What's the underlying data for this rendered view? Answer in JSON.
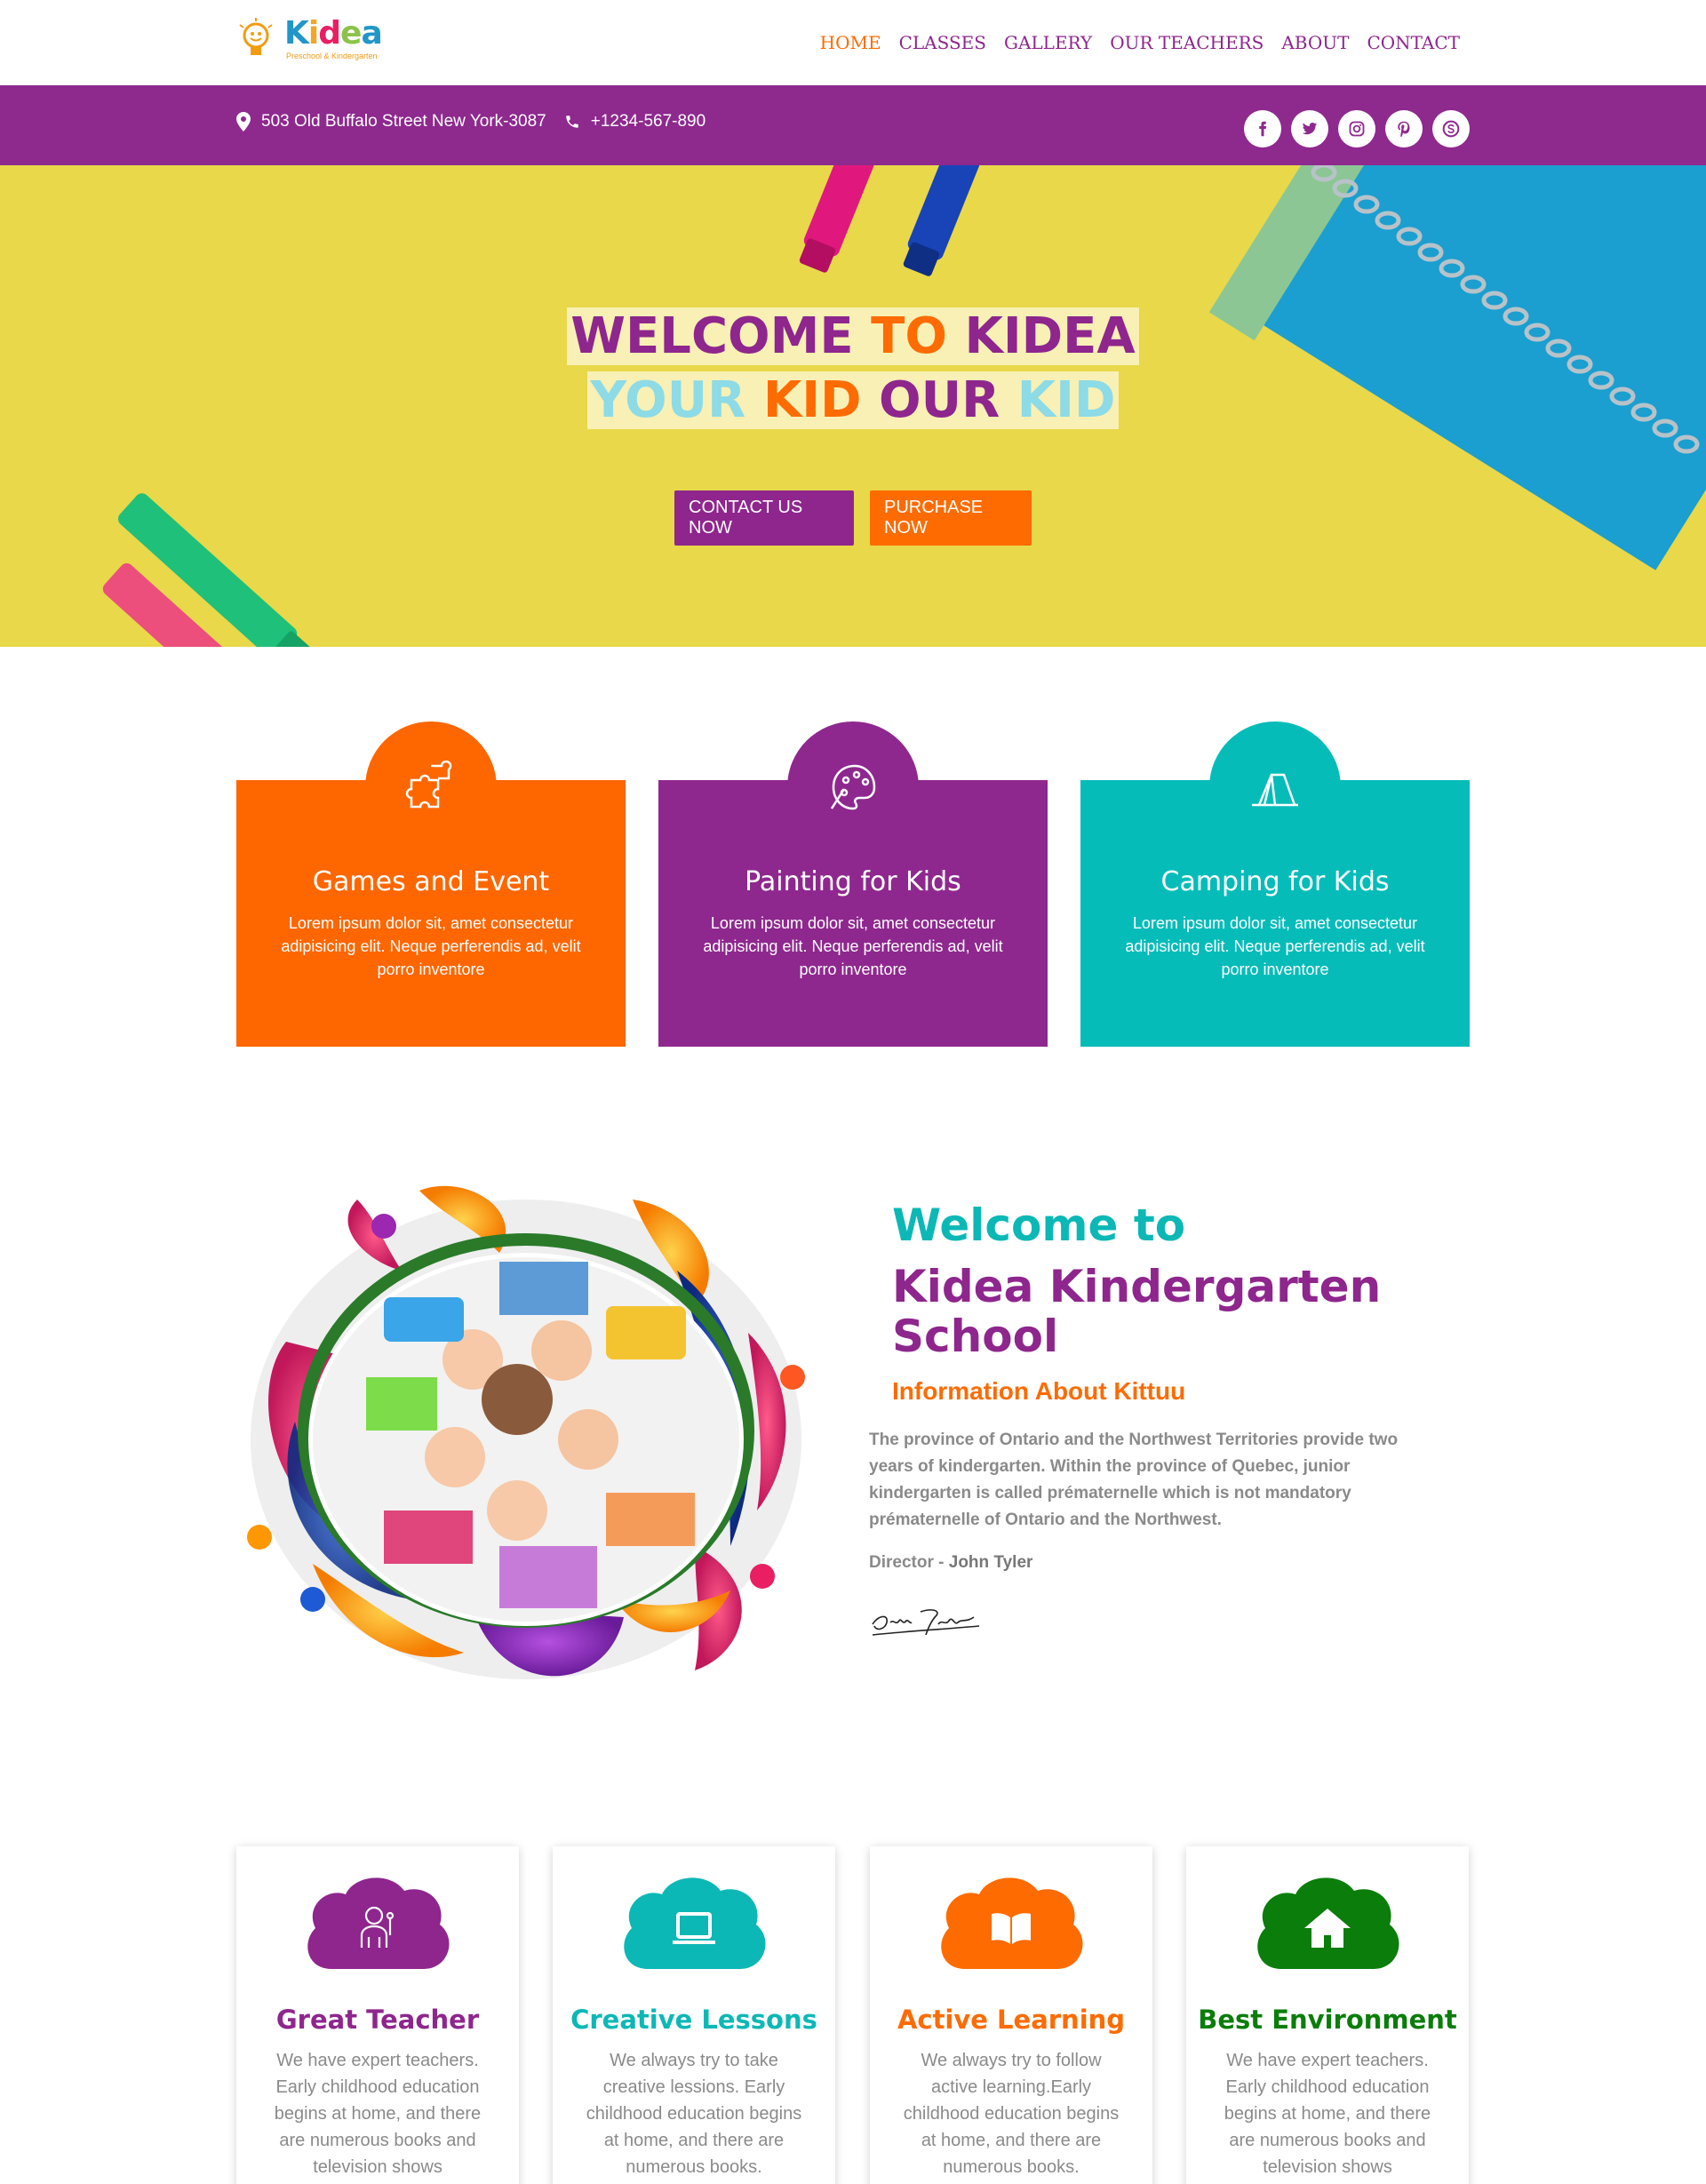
{
  "header": {
    "logo": {
      "word": "Kidea",
      "tagline": "Preschool & Kindergarten"
    },
    "nav": [
      "HOME",
      "CLASSES",
      "GALLERY",
      "OUR TEACHERS",
      "ABOUT",
      "CONTACT"
    ],
    "active_nav": "HOME"
  },
  "infobar": {
    "address": "503 Old Buffalo Street New York-3087",
    "phone": "+1234-567-890",
    "socials": [
      "facebook-icon",
      "twitter-icon",
      "instagram-icon",
      "pinterest-icon",
      "skype-icon"
    ]
  },
  "hero": {
    "line1": [
      "WELCOME",
      "TO",
      "KIDEA"
    ],
    "line2": [
      "YOUR",
      "KID",
      "OUR",
      "KID"
    ],
    "contact_button": "CONTACT US NOW",
    "purchase_button": "PURCHASE NOW"
  },
  "features": [
    {
      "icon": "puzzle-icon",
      "title": "Games and Event",
      "text": "Lorem ipsum dolor sit, amet consectetur adipisicing elit. Neque perferendis ad, velit porro inventore",
      "color": "#fe6600"
    },
    {
      "icon": "palette-icon",
      "title": "Painting for Kids",
      "text": "Lorem ipsum dolor sit, amet consectetur adipisicing elit. Neque perferendis ad, velit porro inventore",
      "color": "#8e288e"
    },
    {
      "icon": "tent-icon",
      "title": "Camping for Kids",
      "text": "Lorem ipsum dolor sit, amet consectetur adipisicing elit. Neque perferendis ad, velit porro inventore",
      "color": "#06bcb9"
    }
  ],
  "welcome": {
    "heading1": "Welcome to",
    "heading2": "Kidea Kindergarten School",
    "subheading": "Information About Kittuu",
    "paragraph": "The province of Ontario and the Northwest Territories provide two years of kindergarten. Within the province of Quebec, junior kindergarten is called prématernelle which is not mandatory prématernelle of Ontario and the Northwest.",
    "director_label": "Director - ",
    "director_name": "John Tyler"
  },
  "benefits": [
    {
      "icon": "teacher-icon",
      "title": "Great Teacher",
      "text": "We have expert teachers. Early childhood education begins at home, and there are numerous books and television shows",
      "color": "#8e268d"
    },
    {
      "icon": "laptop-icon",
      "title": "Creative Lessons",
      "text": "We always try to take creative lessions. Early childhood education begins at home, and there are numerous books.",
      "color": "#0cb8b6"
    },
    {
      "icon": "book-icon",
      "title": "Active Learning",
      "text": "We always try to follow active learning.Early childhood education begins at home, and there are numerous books.",
      "color": "#fe6b00"
    },
    {
      "icon": "home-icon",
      "title": "Best Environment",
      "text": "We have expert teachers. Early childhood education begins at home, and there are numerous books and television shows",
      "color": "#0a7d0a"
    }
  ]
}
